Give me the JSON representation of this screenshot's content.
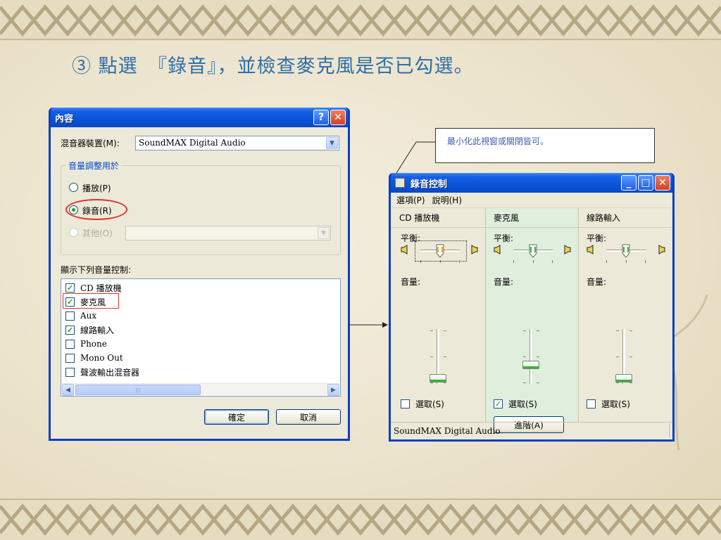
{
  "heading": "③ 點選　『錄音』，並檢查麥克風是否已勾選。",
  "note": "最小化此視窗或關閉皆可。",
  "properties_dialog": {
    "title": "內容",
    "help_label": "?",
    "close_label": "✕",
    "mixer_device_label": "混音器裝置(M):",
    "mixer_device_value": "SoundMAX Digital Audio",
    "adjust_group_label": "音量調整用於",
    "radio_playback": "播放(P)",
    "radio_recording": "錄音(R)",
    "radio_other": "其他(O)",
    "selected_radio": "錄音(R)",
    "show_controls_label": "顯示下列音量控制:",
    "controls": [
      {
        "label": "CD 播放機",
        "checked": true
      },
      {
        "label": "麥克風",
        "checked": true
      },
      {
        "label": "Aux",
        "checked": false
      },
      {
        "label": "線路輸入",
        "checked": true
      },
      {
        "label": "Phone",
        "checked": false
      },
      {
        "label": "Mono Out",
        "checked": false
      },
      {
        "label": "聲波輸出混音器",
        "checked": false
      }
    ],
    "ok_label": "確定",
    "cancel_label": "取消"
  },
  "recording_control": {
    "title": "錄音控制",
    "minimize_label": "_",
    "maximize_label": "□",
    "close_label": "✕",
    "menu": [
      "選項(P)",
      "說明(H)"
    ],
    "balance_label": "平衡:",
    "volume_label": "音量:",
    "select_label": "選取(S)",
    "columns": [
      {
        "name": "CD 播放機",
        "selected": false,
        "volume": 0.1,
        "balance": 0.5
      },
      {
        "name": "麥克風",
        "selected": true,
        "volume": 0.35,
        "balance": 0.5
      },
      {
        "name": "線路輸入",
        "selected": false,
        "volume": 0.1,
        "balance": 0.5
      }
    ],
    "advanced_label": "進階(A)",
    "status": "SoundMAX Digital Audio"
  },
  "colors": {
    "heading": "#2b6fa8",
    "xp_title": "#0a54d8",
    "highlight": "#e03030",
    "check": "#21a121"
  }
}
